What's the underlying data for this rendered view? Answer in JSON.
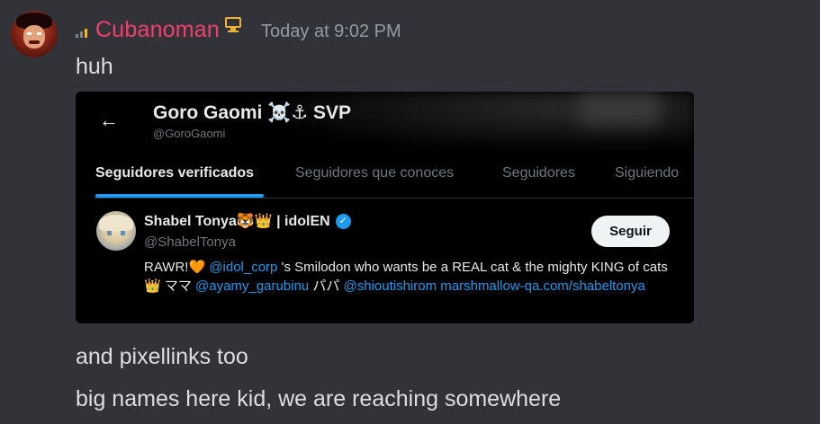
{
  "message": {
    "username": "Cubanoman",
    "timestamp": "Today at 9:02 PM",
    "text1": "huh",
    "text2": "and pixellinks too",
    "text3": "big names here kid, we are reaching somewhere",
    "username_color": "#f23f6f"
  },
  "embed": {
    "back_icon": "←",
    "profile_name": "Goro Gaomi ☠️⚓ SVP",
    "profile_handle": "@GoroGaomi",
    "tabs": [
      "Seguidores verificados",
      "Seguidores que conoces",
      "Seguidores",
      "Siguiendo"
    ],
    "active_tab_index": 0,
    "user": {
      "name": "Shabel Tonya🐯👑 | idolEN",
      "verified_icon": "✓",
      "handle": "@ShabelTonya",
      "follow_label": "Seguir",
      "bio": {
        "p1": "RAWR!🧡 ",
        "link1": "@idol_corp",
        "p2": " 's Smilodon who wants be a REAL cat & the mighty KING of cats👑 ママ ",
        "link2": "@ayamy_garubinu",
        "p3": " パパ ",
        "link3": "@shioutishirom",
        "p4": " ",
        "link4": "marshmallow-qa.com/shabeltonya"
      }
    },
    "accent_color": "#1d9bf0"
  }
}
